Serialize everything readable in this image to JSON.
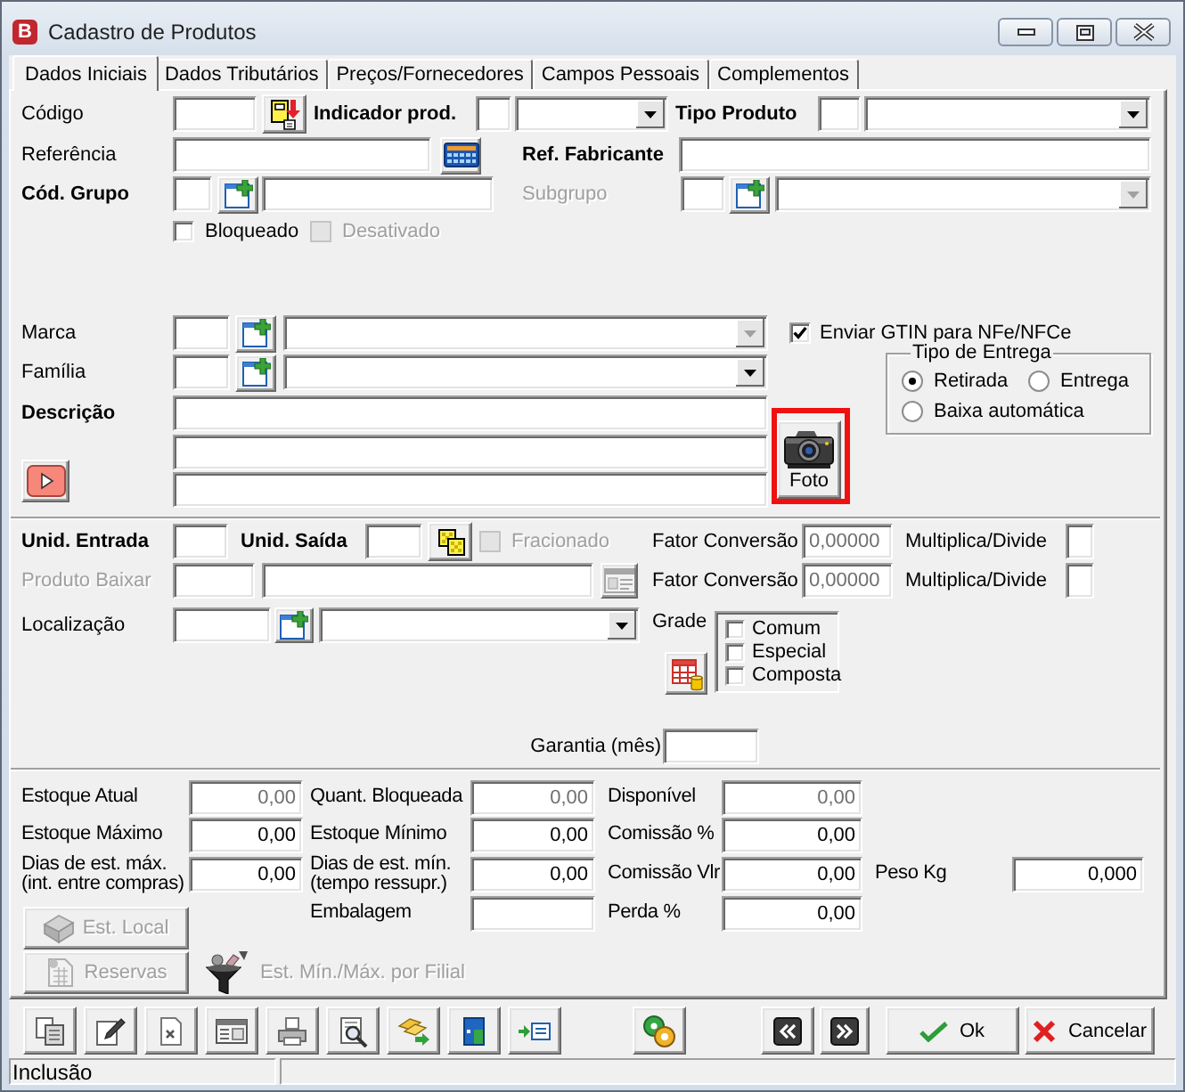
{
  "window": {
    "title": "Cadastro de Produtos",
    "logo_letter": "B"
  },
  "tabs": [
    {
      "label": "Dados Iniciais",
      "selected": true
    },
    {
      "label": "Dados Tributários",
      "selected": false
    },
    {
      "label": "Preços/Fornecedores",
      "selected": false
    },
    {
      "label": "Campos Pessoais",
      "selected": false
    },
    {
      "label": "Complementos",
      "selected": false
    }
  ],
  "general": {
    "codigo": {
      "label": "Código"
    },
    "indicador_prod": {
      "label": "Indicador prod."
    },
    "tipo_produto": {
      "label": "Tipo Produto"
    },
    "referencia": {
      "label": "Referência"
    },
    "ref_fabricante": {
      "label": "Ref. Fabricante"
    },
    "cod_grupo": {
      "label": "Cód. Grupo"
    },
    "subgrupo": {
      "label": "Subgrupo",
      "disabled": true
    },
    "flags": [
      {
        "label": "Bloqueado",
        "checked": false,
        "disabled": false
      },
      {
        "label": "Desativado",
        "checked": false,
        "disabled": true
      }
    ],
    "marca": {
      "label": "Marca",
      "disabled": true
    },
    "familia": {
      "label": "Família",
      "disabled": false
    },
    "enviar_gtin": {
      "label": "Enviar GTIN para NFe/NFCe",
      "checked": true
    },
    "tipo_entrega": {
      "title": "Tipo de Entrega",
      "options": [
        {
          "label": "Retirada",
          "selected": true
        },
        {
          "label": "Entrega",
          "selected": false
        },
        {
          "label": "Baixa automática",
          "selected": false
        }
      ]
    },
    "descricao": {
      "label": "Descrição"
    },
    "foto_button": {
      "label": "Foto",
      "highlighted": true
    }
  },
  "units": {
    "unid_entrada": {
      "label": "Unid. Entrada"
    },
    "unid_saida": {
      "label": "Unid. Saída"
    },
    "fracionado": {
      "label": "Fracionado",
      "checked": false,
      "disabled": true
    },
    "produto_baixar": {
      "label": "Produto Baixar",
      "disabled": true
    },
    "localizacao": {
      "label": "Localização"
    },
    "conversions": [
      {
        "label": "Fator Conversão",
        "value": "0,00000",
        "readonly": true,
        "mode_label": "Multiplica/Divide"
      },
      {
        "label": "Fator Conversão",
        "value": "0,00000",
        "readonly": true,
        "mode_label": "Multiplica/Divide"
      }
    ],
    "grade": {
      "label": "Grade",
      "options": [
        {
          "label": "Comum",
          "checked": false
        },
        {
          "label": "Especial",
          "checked": false
        },
        {
          "label": "Composta",
          "checked": false
        }
      ]
    },
    "garantia": {
      "label": "Garantia (mês)"
    }
  },
  "stock": {
    "rows": [
      [
        {
          "label": "Estoque Atual",
          "value": "0,00",
          "readonly": true
        },
        {
          "label": "Quant. Bloqueada",
          "value": "0,00",
          "readonly": true
        },
        {
          "label": "Disponível",
          "value": "0,00",
          "readonly": true
        }
      ],
      [
        {
          "label": "Estoque Máximo",
          "value": "0,00",
          "readonly": false
        },
        {
          "label": "Estoque Mínimo",
          "value": "0,00",
          "readonly": false
        },
        {
          "label": "Comissão %",
          "value": "0,00",
          "readonly": false
        }
      ],
      [
        {
          "label": "Dias de est. máx.\n(int. entre compras)",
          "value": "0,00",
          "readonly": false
        },
        {
          "label": "Dias de est. mín.\n(tempo ressupr.)",
          "value": "0,00",
          "readonly": false
        },
        {
          "label": "Comissão Vlr",
          "value": "0,00",
          "readonly": false
        },
        {
          "label": "Peso Kg",
          "value": "0,000",
          "readonly": false
        }
      ]
    ],
    "embalagem": {
      "label": "Embalagem"
    },
    "perda": {
      "label": "Perda %",
      "value": "0,00"
    },
    "buttons": [
      {
        "label": "Est. Local",
        "disabled": true
      },
      {
        "label": "Reservas",
        "disabled": true
      }
    ],
    "filial_link": {
      "label": "Est. Mín./Máx. por Filial",
      "disabled": true
    }
  },
  "footer_buttons": [
    {
      "label": "Ok",
      "kind": "confirm"
    },
    {
      "label": "Cancelar",
      "kind": "cancel"
    }
  ],
  "status_bar": {
    "mode": "Inclusão"
  }
}
